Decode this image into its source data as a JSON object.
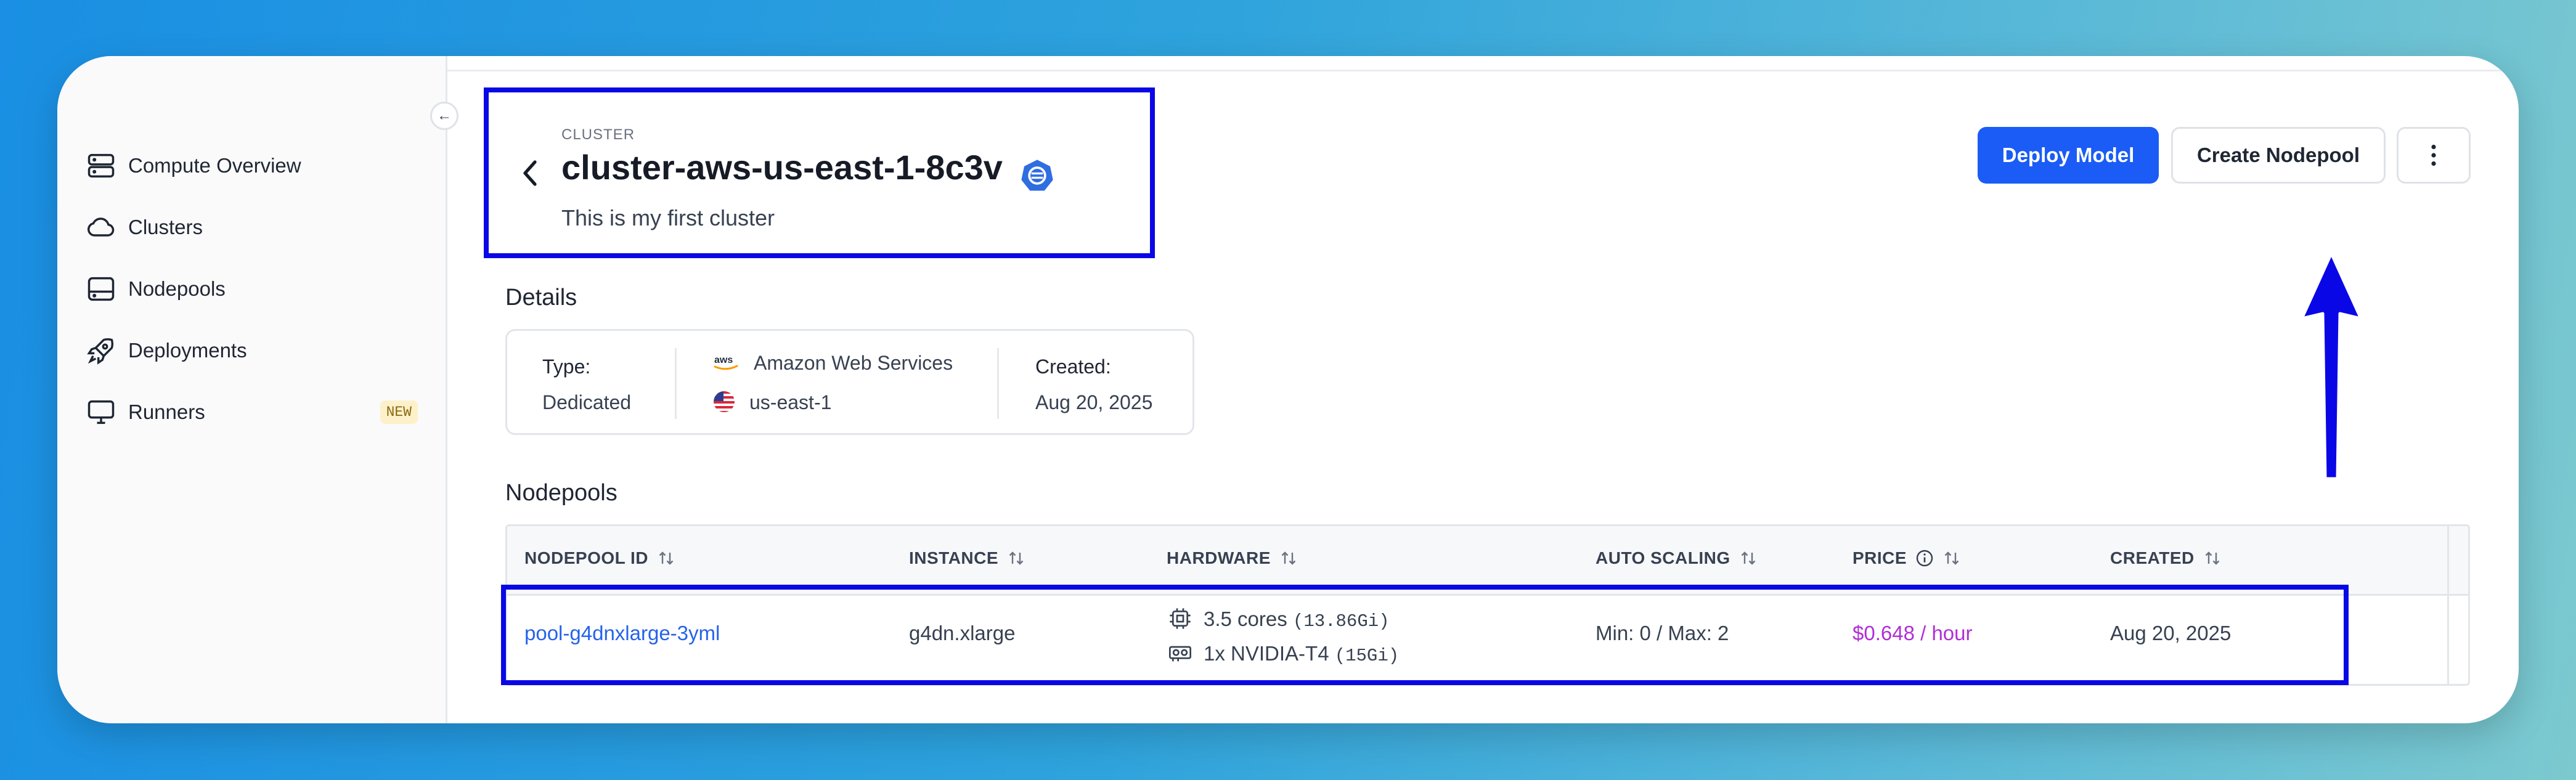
{
  "sidebar": {
    "items": [
      {
        "label": "Compute Overview",
        "icon": "server-stack-icon"
      },
      {
        "label": "Clusters",
        "icon": "cloud-icon"
      },
      {
        "label": "Nodepools",
        "icon": "drive-icon"
      },
      {
        "label": "Deployments",
        "icon": "rocket-icon"
      },
      {
        "label": "Runners",
        "icon": "monitor-icon",
        "badge": "NEW"
      }
    ]
  },
  "header": {
    "eyebrow": "CLUSTER",
    "title": "cluster-aws-us-east-1-8c3v",
    "description": "This is my first cluster",
    "buttons": {
      "deploy": "Deploy Model",
      "create_nodepool": "Create Nodepool"
    }
  },
  "details": {
    "title": "Details",
    "type_label": "Type:",
    "type_value": "Dedicated",
    "provider": "Amazon Web Services",
    "region": "us-east-1",
    "created_label": "Created:",
    "created_value": "Aug 20, 2025"
  },
  "nodepools": {
    "title": "Nodepools",
    "columns": [
      "NODEPOOL ID",
      "INSTANCE",
      "HARDWARE",
      "AUTO SCALING",
      "PRICE",
      "CREATED"
    ],
    "rows": [
      {
        "id": "pool-g4dnxlarge-3yml",
        "instance": "g4dn.xlarge",
        "cpu": "3.5 cores",
        "cpu_mem": "(13.86Gi)",
        "gpu": "1x NVIDIA-T4",
        "gpu_mem": "(15Gi)",
        "scaling": "Min: 0 / Max: 2",
        "price": "$0.648 / hour",
        "created": "Aug 20, 2025"
      }
    ]
  },
  "colors": {
    "primary": "#1a5cf5",
    "highlight": "#0a07e6",
    "link": "#2563eb",
    "price": "#b02fd6"
  }
}
